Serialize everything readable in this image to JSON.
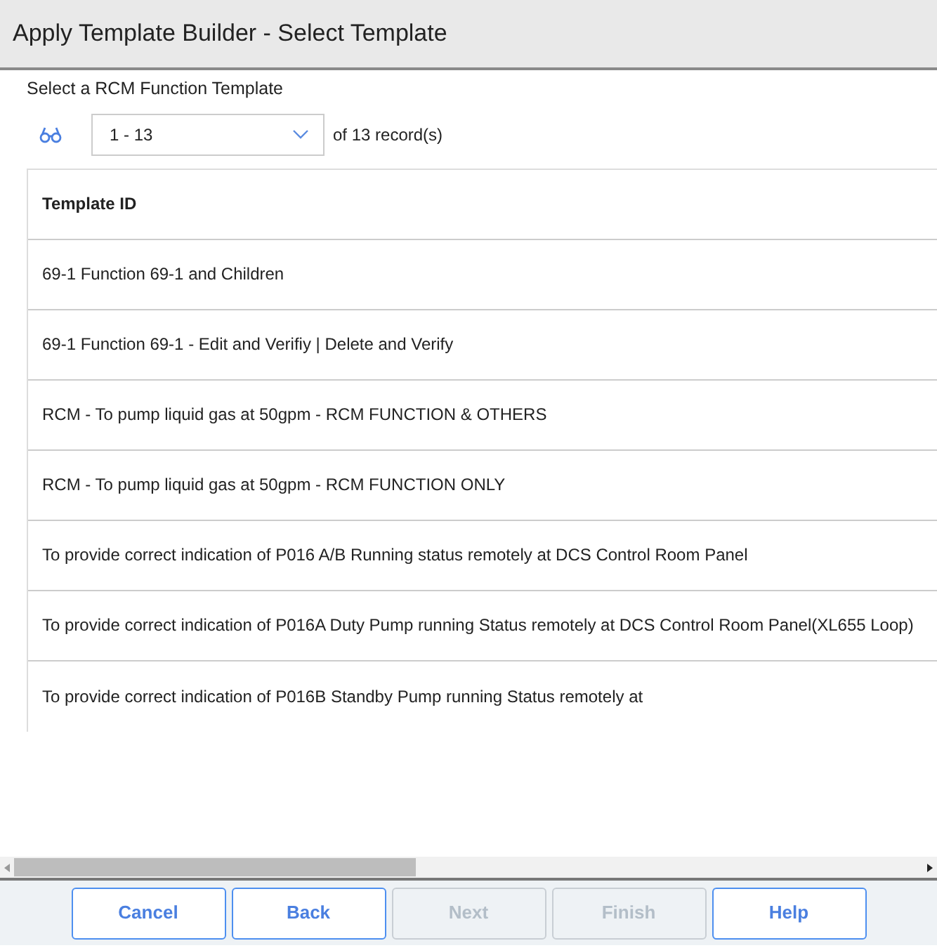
{
  "window": {
    "title": "Apply Template Builder - Select Template"
  },
  "heading": "Select a RCM Function Template",
  "pager": {
    "value": "1 - 13",
    "total": "of 13 record(s)"
  },
  "table": {
    "columns": [
      "Template ID"
    ],
    "rows": [
      [
        "69-1 Function 69-1 and Children"
      ],
      [
        "69-1 Function 69-1 - Edit and Verifiy | Delete and Verify"
      ],
      [
        "RCM - To pump liquid gas at 50gpm - RCM FUNCTION & OTHERS"
      ],
      [
        "RCM - To pump liquid gas at 50gpm - RCM FUNCTION ONLY"
      ],
      [
        "To provide correct indication of P016 A/B Running status remotely at DCS Control Room Panel"
      ],
      [
        "To provide correct indication of P016A Duty Pump running Status remotely at DCS Control Room Panel(XL655 Loop)"
      ],
      [
        "To provide correct indication of P016B Standby Pump running Status remotely at"
      ]
    ]
  },
  "buttons": [
    {
      "label": "Cancel",
      "disabled": false
    },
    {
      "label": "Back",
      "disabled": false
    },
    {
      "label": "Next",
      "disabled": true
    },
    {
      "label": "Finish",
      "disabled": true
    },
    {
      "label": "Help",
      "disabled": false
    }
  ]
}
